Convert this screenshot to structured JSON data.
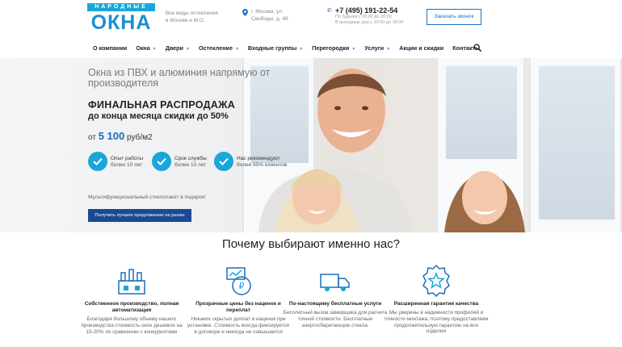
{
  "logo": {
    "top": "НАРОДНЫЕ",
    "main": "ОКНА"
  },
  "header": {
    "tagline": [
      "Все виды остекления",
      "в Москве и М.О."
    ],
    "address": [
      "г. Москва, ул.",
      "Свободы, д. 48"
    ],
    "phone": "+7 (495) 191-22-54",
    "hours": [
      "По будням с 09:00 до 20:00",
      "В выходные дни с 10:00 до 18:00"
    ],
    "callback_label": "Заказать звонок"
  },
  "nav": [
    {
      "label": "О компании",
      "dropdown": false
    },
    {
      "label": "Окна",
      "dropdown": true
    },
    {
      "label": "Двери",
      "dropdown": true
    },
    {
      "label": "Остекление",
      "dropdown": true
    },
    {
      "label": "Входные группы",
      "dropdown": true
    },
    {
      "label": "Перегородки",
      "dropdown": true
    },
    {
      "label": "Услуги",
      "dropdown": true
    },
    {
      "label": "Акции и скидки",
      "dropdown": false
    },
    {
      "label": "Контакты",
      "dropdown": false
    }
  ],
  "hero": {
    "subtitle": "Окна из ПВХ и алюминия напрямую от производителя",
    "title": "ФИНАЛЬНАЯ РАСПРОДАЖА",
    "title2": "до конца месяца скидки до 50%",
    "price_prefix": "от",
    "price_value": "5 100",
    "price_unit": "руб/м2",
    "features": [
      {
        "title": "Опыт работы",
        "text": "более 10 лет"
      },
      {
        "title": "Срок службы",
        "text": "более 10 лет"
      },
      {
        "title": "Нас рекомендуют",
        "text": "более 95% клиентов"
      }
    ],
    "gift": "Мультифункциональный стеклопакет в подарок!",
    "offer_button": "Получить лучшее предложение на рынке"
  },
  "why": {
    "title": "Почему выбирают именно нас?",
    "items": [
      {
        "icon": "factory-icon",
        "name": "Собственное производство, полная автоматизация",
        "desc": "Благодаря большому объему нашего производства стоимость окон дешевле на 15-20% по сравнению с конкурентами"
      },
      {
        "icon": "price-tag-icon",
        "name": "Прозрачные цены без наценок и переплат",
        "desc": "Никаких скрытых доплат и наценок при установке. Стоимость всегда фиксируется в договоре и никогда не повышается"
      },
      {
        "icon": "truck-icon",
        "name": "По-настоящему бесплатные услуги",
        "desc": "Бесплатный вызов замерщика для расчета точной стоимости. Бесплатные энергосберегающие стекла."
      },
      {
        "icon": "quality-badge-icon",
        "name": "Расширенная гарантия качества",
        "desc": "Мы уверены в надежности профилей и точности монтажа, поэтому предоставляем продолжительную гарантию на все изделия"
      }
    ]
  },
  "colors": {
    "accent": "#1aa6d9",
    "brand": "#1b6fbf",
    "button": "#1b4a93"
  }
}
